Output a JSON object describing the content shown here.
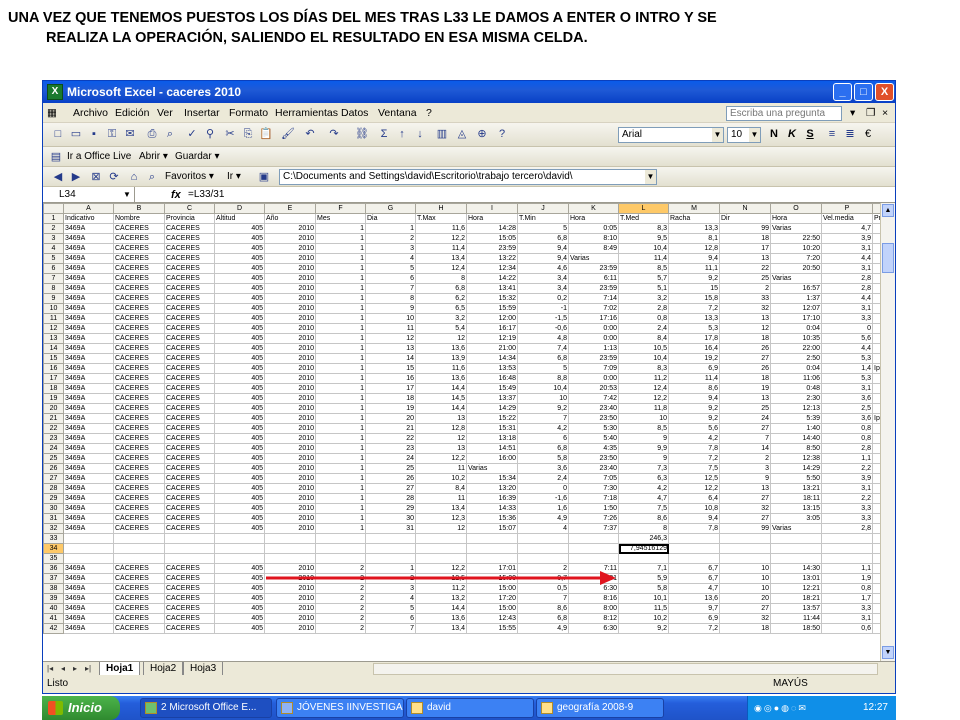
{
  "caption": {
    "line1": "UNA VEZ QUE TENEMOS PUESTOS LOS DÍAS DEL MES TRAS L33 LE DAMOS A ENTER O INTRO Y SE",
    "line2": "REALIZA LA OPERACIÓN, SALIENDO EL RESULTADO EN ESA MISMA CELDA."
  },
  "window": {
    "title": "Microsoft Excel - caceres 2010",
    "minimize": "_",
    "maximize": "□",
    "close": "X"
  },
  "menu": {
    "items": [
      "Archivo",
      "Edición",
      "Ver",
      "Insertar",
      "Formato",
      "Herramientas",
      "Datos",
      "Ventana",
      "?"
    ],
    "ask_placeholder": "Escriba una pregunta"
  },
  "toolbar": {
    "font": "Arial",
    "size": "10",
    "bold": "N",
    "italic": "K",
    "underline": "S",
    "euro": "€",
    "sigma": "Σ",
    "web_toolbar": [
      "Ir a Office Live",
      "Abrir ▾",
      "Guardar ▾"
    ],
    "favorites": "Favoritos ▾",
    "go": "Ir ▾",
    "address": "C:\\Documents and Settings\\david\\Escritorio\\trabajo tercero\\david\\"
  },
  "formula_bar": {
    "name_box": "L34",
    "fx": "fx",
    "formula": "=L33/31"
  },
  "sheet": {
    "columns": [
      "A",
      "B",
      "C",
      "D",
      "E",
      "F",
      "G",
      "H",
      "I",
      "J",
      "K",
      "L",
      "M",
      "N",
      "O",
      "P"
    ],
    "header_row": [
      "Indicativo",
      "Nombre",
      "Provincia",
      "Altitud",
      "Año",
      "Mes",
      "Dia",
      "T.Max",
      "Hora",
      "T.Min",
      "Hora",
      "T.Med",
      "Racha",
      "Dir",
      "Hora",
      "Vel.media",
      "Prec"
    ],
    "rows": [
      [
        "2",
        "3469A",
        "CÁCERES",
        "CACERES",
        "405",
        "2010",
        "1",
        "1",
        "11,6",
        "14:28",
        "5",
        "0:05",
        "8,3",
        "13,3",
        "99",
        "Varias",
        "4,7",
        ""
      ],
      [
        "3",
        "3469A",
        "CÁCERES",
        "CACERES",
        "405",
        "2010",
        "1",
        "2",
        "12,2",
        "15:05",
        "6,8",
        "8:10",
        "9,5",
        "8,1",
        "18",
        "22:50",
        "3,9",
        ""
      ],
      [
        "4",
        "3469A",
        "CÁCERES",
        "CACERES",
        "405",
        "2010",
        "1",
        "3",
        "11,4",
        "23:59",
        "9,4",
        "8:49",
        "10,4",
        "12,8",
        "17",
        "10:20",
        "3,1",
        ""
      ],
      [
        "5",
        "3469A",
        "CÁCERES",
        "CACERES",
        "405",
        "2010",
        "1",
        "4",
        "13,4",
        "13:22",
        "9,4",
        "Varias",
        "11,4",
        "9,4",
        "13",
        "7:20",
        "4,4",
        ""
      ],
      [
        "6",
        "3469A",
        "CÁCERES",
        "CACERES",
        "405",
        "2010",
        "1",
        "5",
        "12,4",
        "12:34",
        "4,6",
        "23:59",
        "8,5",
        "11,1",
        "22",
        "20:50",
        "3,1",
        ""
      ],
      [
        "7",
        "3469A",
        "CÁCERES",
        "CACERES",
        "405",
        "2010",
        "1",
        "6",
        "8",
        "14:22",
        "3,4",
        "6:11",
        "5,7",
        "9,2",
        "25",
        "Varias",
        "2,8",
        ""
      ],
      [
        "8",
        "3469A",
        "CÁCERES",
        "CACERES",
        "405",
        "2010",
        "1",
        "7",
        "6,8",
        "13:41",
        "3,4",
        "23:59",
        "5,1",
        "15",
        "2",
        "16:57",
        "2,8",
        ""
      ],
      [
        "9",
        "3469A",
        "CÁCERES",
        "CACERES",
        "405",
        "2010",
        "1",
        "8",
        "6,2",
        "15:32",
        "0,2",
        "7:14",
        "3,2",
        "15,8",
        "33",
        "1:37",
        "4,4",
        ""
      ],
      [
        "10",
        "3469A",
        "CÁCERES",
        "CACERES",
        "405",
        "2010",
        "1",
        "9",
        "6,5",
        "15:59",
        "-1",
        "7:02",
        "2,8",
        "7,2",
        "32",
        "12:07",
        "3,1",
        ""
      ],
      [
        "11",
        "3469A",
        "CÁCERES",
        "CACERES",
        "405",
        "2010",
        "1",
        "10",
        "3,2",
        "12:00",
        "-1,5",
        "17:16",
        "0,8",
        "13,3",
        "13",
        "17:10",
        "3,3",
        ""
      ],
      [
        "12",
        "3469A",
        "CÁCERES",
        "CACERES",
        "405",
        "2010",
        "1",
        "11",
        "5,4",
        "16:17",
        "-0,6",
        "0:00",
        "2,4",
        "5,3",
        "12",
        "0:04",
        "0",
        ""
      ],
      [
        "13",
        "3469A",
        "CÁCERES",
        "CACERES",
        "405",
        "2010",
        "1",
        "12",
        "12",
        "12:19",
        "4,8",
        "0:00",
        "8,4",
        "17,8",
        "18",
        "10:35",
        "5,6",
        ""
      ],
      [
        "14",
        "3469A",
        "CÁCERES",
        "CACERES",
        "405",
        "2010",
        "1",
        "13",
        "13,6",
        "21:00",
        "7,4",
        "1:13",
        "10,5",
        "16,4",
        "26",
        "22:00",
        "4,4",
        ""
      ],
      [
        "15",
        "3469A",
        "CÁCERES",
        "CACERES",
        "405",
        "2010",
        "1",
        "14",
        "13,9",
        "14:34",
        "6,8",
        "23:59",
        "10,4",
        "19,2",
        "27",
        "2:50",
        "5,3",
        ""
      ],
      [
        "16",
        "3469A",
        "CÁCERES",
        "CACERES",
        "405",
        "2010",
        "1",
        "15",
        "11,6",
        "13:53",
        "5",
        "7:09",
        "8,3",
        "6,9",
        "26",
        "0:04",
        "1,4",
        "Ip"
      ],
      [
        "17",
        "3469A",
        "CÁCERES",
        "CACERES",
        "405",
        "2010",
        "1",
        "16",
        "13,6",
        "16:48",
        "8,8",
        "0:00",
        "11,2",
        "11,4",
        "18",
        "11:06",
        "5,3",
        ""
      ],
      [
        "18",
        "3469A",
        "CÁCERES",
        "CACERES",
        "405",
        "2010",
        "1",
        "17",
        "14,4",
        "15:49",
        "10,4",
        "20:53",
        "12,4",
        "8,6",
        "19",
        "0:48",
        "3,1",
        ""
      ],
      [
        "19",
        "3469A",
        "CÁCERES",
        "CACERES",
        "405",
        "2010",
        "1",
        "18",
        "14,5",
        "13:37",
        "10",
        "7:42",
        "12,2",
        "9,4",
        "13",
        "2:30",
        "3,6",
        ""
      ],
      [
        "20",
        "3469A",
        "CÁCERES",
        "CACERES",
        "405",
        "2010",
        "1",
        "19",
        "14,4",
        "14:29",
        "9,2",
        "23:40",
        "11,8",
        "9,2",
        "25",
        "12:13",
        "2,5",
        ""
      ],
      [
        "21",
        "3469A",
        "CÁCERES",
        "CACERES",
        "405",
        "2010",
        "1",
        "20",
        "13",
        "15:22",
        "7",
        "23:50",
        "10",
        "9,2",
        "24",
        "5:39",
        "3,6",
        "Ip"
      ],
      [
        "22",
        "3469A",
        "CÁCERES",
        "CACERES",
        "405",
        "2010",
        "1",
        "21",
        "12,8",
        "15:31",
        "4,2",
        "5:30",
        "8,5",
        "5,6",
        "27",
        "1:40",
        "0,8",
        ""
      ],
      [
        "23",
        "3469A",
        "CÁCERES",
        "CACERES",
        "405",
        "2010",
        "1",
        "22",
        "12",
        "13:18",
        "6",
        "5:40",
        "9",
        "4,2",
        "7",
        "14:40",
        "0,8",
        ""
      ],
      [
        "24",
        "3469A",
        "CÁCERES",
        "CACERES",
        "405",
        "2010",
        "1",
        "23",
        "13",
        "14:51",
        "6,8",
        "4:35",
        "9,9",
        "7,8",
        "14",
        "8:50",
        "2,8",
        ""
      ],
      [
        "25",
        "3469A",
        "CÁCERES",
        "CACERES",
        "405",
        "2010",
        "1",
        "24",
        "12,2",
        "16:00",
        "5,8",
        "23:50",
        "9",
        "7,2",
        "2",
        "12:38",
        "1,1",
        ""
      ],
      [
        "26",
        "3469A",
        "CÁCERES",
        "CACERES",
        "405",
        "2010",
        "1",
        "25",
        "11",
        "Varias",
        "3,6",
        "23:40",
        "7,3",
        "7,5",
        "3",
        "14:29",
        "2,2",
        ""
      ],
      [
        "27",
        "3469A",
        "CÁCERES",
        "CACERES",
        "405",
        "2010",
        "1",
        "26",
        "10,2",
        "15:34",
        "2,4",
        "7:05",
        "6,3",
        "12,5",
        "9",
        "5:50",
        "3,9",
        ""
      ],
      [
        "28",
        "3469A",
        "CÁCERES",
        "CACERES",
        "405",
        "2010",
        "1",
        "27",
        "8,4",
        "13:20",
        "0",
        "7:30",
        "4,2",
        "12,2",
        "13",
        "13:21",
        "3,1",
        ""
      ],
      [
        "29",
        "3469A",
        "CÁCERES",
        "CACERES",
        "405",
        "2010",
        "1",
        "28",
        "11",
        "16:39",
        "-1,6",
        "7:18",
        "4,7",
        "6,4",
        "27",
        "18:11",
        "2,2",
        ""
      ],
      [
        "30",
        "3469A",
        "CÁCERES",
        "CACERES",
        "405",
        "2010",
        "1",
        "29",
        "13,4",
        "14:33",
        "1,6",
        "1:50",
        "7,5",
        "10,8",
        "32",
        "13:15",
        "3,3",
        ""
      ],
      [
        "31",
        "3469A",
        "CÁCERES",
        "CACERES",
        "405",
        "2010",
        "1",
        "30",
        "12,3",
        "15:36",
        "4,9",
        "7:26",
        "8,6",
        "9,4",
        "27",
        "3:05",
        "3,3",
        ""
      ],
      [
        "32",
        "3469A",
        "CÁCERES",
        "CACERES",
        "405",
        "2010",
        "1",
        "31",
        "12",
        "15:07",
        "4",
        "7:37",
        "8",
        "7,8",
        "99",
        "Varias",
        "2,8",
        ""
      ],
      [
        "33",
        "",
        "",
        "",
        "",
        "",
        "",
        "",
        "",
        "",
        "",
        "",
        "246,3",
        "",
        "",
        "",
        "",
        ""
      ],
      [
        "34",
        "",
        "",
        "",
        "",
        "",
        "",
        "",
        "",
        "",
        "",
        "",
        "7,94516129",
        "",
        "",
        "",
        "",
        ""
      ],
      [
        "35",
        "",
        "",
        "",
        "",
        "",
        "",
        "",
        "",
        "",
        "",
        "",
        "",
        "",
        "",
        "",
        "",
        ""
      ],
      [
        "36",
        "3469A",
        "CÁCERES",
        "CACERES",
        "405",
        "2010",
        "2",
        "1",
        "12,2",
        "17:01",
        "2",
        "7:11",
        "7,1",
        "6,7",
        "10",
        "14:30",
        "1,1",
        ""
      ],
      [
        "37",
        "3469A",
        "CÁCERES",
        "CACERES",
        "405",
        "2010",
        "2",
        "2",
        "12,5",
        "15:00",
        "-0,7",
        "6:31",
        "5,9",
        "6,7",
        "10",
        "13:01",
        "1,9",
        ""
      ],
      [
        "38",
        "3469A",
        "CÁCERES",
        "CACERES",
        "405",
        "2010",
        "2",
        "3",
        "11,2",
        "15:00",
        "0,5",
        "6:30",
        "5,8",
        "4,7",
        "10",
        "12:21",
        "0,8",
        ""
      ],
      [
        "39",
        "3469A",
        "CÁCERES",
        "CACERES",
        "405",
        "2010",
        "2",
        "4",
        "13,2",
        "17:20",
        "7",
        "8:16",
        "10,1",
        "13,6",
        "20",
        "18:21",
        "1,7",
        ""
      ],
      [
        "40",
        "3469A",
        "CÁCERES",
        "CACERES",
        "405",
        "2010",
        "2",
        "5",
        "14,4",
        "15:00",
        "8,6",
        "8:00",
        "11,5",
        "9,7",
        "27",
        "13:57",
        "3,3",
        ""
      ],
      [
        "41",
        "3469A",
        "CÁCERES",
        "CACERES",
        "405",
        "2010",
        "2",
        "6",
        "13,6",
        "12:43",
        "6,8",
        "8:12",
        "10,2",
        "6,9",
        "32",
        "11:44",
        "3,1",
        ""
      ],
      [
        "42",
        "3469A",
        "CÁCERES",
        "CACERES",
        "405",
        "2010",
        "2",
        "7",
        "13,4",
        "15:55",
        "4,9",
        "6:30",
        "9,2",
        "7,2",
        "18",
        "18:50",
        "0,6",
        ""
      ]
    ],
    "tabs": [
      "Hoja1",
      "Hoja2",
      "Hoja3"
    ],
    "nav": [
      "|◂",
      "◂",
      "▸",
      "▸|"
    ]
  },
  "status": {
    "ready": "Listo",
    "caps": "MAYÚS"
  },
  "taskbar": {
    "start": "Inicio",
    "tasks": [
      "2 Microsoft Office E...",
      "JÓVENES IINVESTIGA...",
      "david",
      "geografía 2008-9"
    ],
    "clock": "12:27"
  },
  "colors": {
    "title_blue": "#0a5bea",
    "arrow_red": "#e0141e",
    "taskbar_blue": "#245edb",
    "start_green": "#3a9a3a"
  }
}
